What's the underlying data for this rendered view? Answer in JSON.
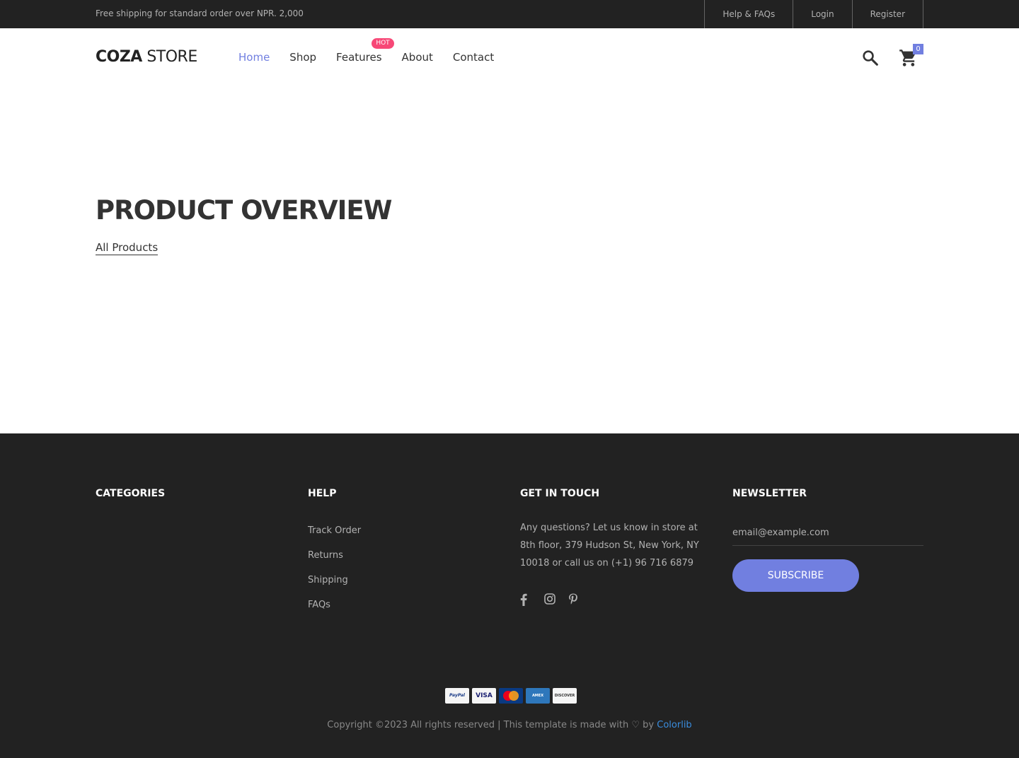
{
  "topbar": {
    "shipping_text": "Free shipping for standard order over NPR. 2,000",
    "links": [
      "Help & FAQs",
      "Login",
      "Register"
    ]
  },
  "header": {
    "logo_bold": "COZA",
    "logo_light": "STORE",
    "nav": [
      "Home",
      "Shop",
      "Features",
      "About",
      "Contact"
    ],
    "active_nav": "Home",
    "hot_badge": "HOT",
    "cart_count": "0"
  },
  "main": {
    "title": "PRODUCT OVERVIEW",
    "link": "All Products"
  },
  "footer": {
    "categories_title": "CATEGORIES",
    "help_title": "HELP",
    "help_links": [
      "Track Order",
      "Returns",
      "Shipping",
      "FAQs"
    ],
    "touch_title": "GET IN TOUCH",
    "touch_text": "Any questions? Let us know in store at 8th floor, 379 Hudson St, New York, NY 10018 or call us on (+1) 96 716 6879",
    "newsletter_title": "NEWSLETTER",
    "email_placeholder": "email@example.com",
    "subscribe_label": "SUBSCRIBE",
    "payment_cards": [
      "PayPal",
      "VISA",
      "MasterCard",
      "AMEX",
      "DISCOVER"
    ],
    "copyright_text": "Copyright ©2023 All rights reserved | This template is made with ♡ by",
    "copyright_link": "Colorlib"
  },
  "colors": {
    "accent": "#717fe0",
    "hot": "#f74877",
    "dark": "#222222"
  },
  "icons": [
    "search-icon",
    "cart-icon",
    "facebook-icon",
    "instagram-icon",
    "pinterest-icon",
    "heart-icon"
  ]
}
